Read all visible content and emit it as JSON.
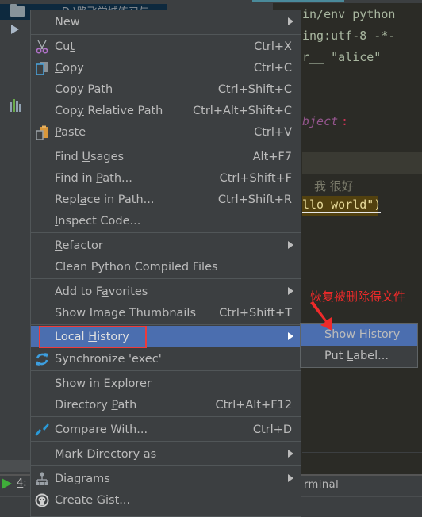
{
  "background": {
    "project_tree": {
      "selected_path": "D:\\路飞学城练习与",
      "expand_arrow": "tree-expand-arrow",
      "structure_icon": "structure-icon"
    },
    "editor": {
      "lines": [
        "in/env python",
        "ing:utf-8 -*-",
        "r__ \"alice\"",
        "bject",
        ":",
        "我 很好",
        "llo world\")"
      ]
    },
    "bottom_bar": {
      "run_tab_num": "4",
      "run_tab_rest": ": R",
      "terminal_tab": "rminal"
    }
  },
  "context_menu": {
    "items": [
      {
        "label": "New",
        "shortcut": "",
        "submenu": true
      },
      {
        "label": "Cut",
        "underline": "t",
        "shortcut": "Ctrl+X",
        "icon": "scissors-icon"
      },
      {
        "label": "Copy",
        "underline": "C",
        "shortcut": "Ctrl+C",
        "icon": "copy-icon"
      },
      {
        "label": "Copy Path",
        "shortcut": "Ctrl+Shift+C"
      },
      {
        "label": "Copy Relative Path",
        "shortcut": "Ctrl+Alt+Shift+C"
      },
      {
        "label": "Paste",
        "underline": "P",
        "shortcut": "Ctrl+V",
        "icon": "paste-icon"
      },
      {
        "label": "Find Usages",
        "shortcut": "Alt+F7"
      },
      {
        "label": "Find in Path...",
        "shortcut": "Ctrl+Shift+F"
      },
      {
        "label": "Replace in Path...",
        "shortcut": "Ctrl+Shift+R"
      },
      {
        "label": "Inspect Code...",
        "shortcut": ""
      },
      {
        "label": "Refactor",
        "shortcut": "",
        "submenu": true
      },
      {
        "label": "Clean Python Compiled Files",
        "shortcut": ""
      },
      {
        "label": "Add to Favorites",
        "shortcut": "",
        "submenu": true
      },
      {
        "label": "Show Image Thumbnails",
        "shortcut": "Ctrl+Shift+T"
      },
      {
        "label": "Local History",
        "shortcut": "",
        "submenu": true,
        "active": true
      },
      {
        "label": "Synchronize 'exec'",
        "shortcut": "",
        "icon": "synchronize-icon"
      },
      {
        "label": "Show in Explorer",
        "shortcut": ""
      },
      {
        "label": "Directory Path",
        "shortcut": "Ctrl+Alt+F12"
      },
      {
        "label": "Compare With...",
        "shortcut": "Ctrl+D",
        "icon": "compare-icon"
      },
      {
        "label": "Mark Directory as",
        "shortcut": "",
        "submenu": true
      },
      {
        "label": "Diagrams",
        "shortcut": "",
        "submenu": true,
        "icon": "diagrams-icon"
      },
      {
        "label": "Create Gist...",
        "shortcut": "",
        "icon": "github-icon"
      }
    ]
  },
  "local_history_submenu": {
    "items": [
      {
        "label": "Show History",
        "active": true
      },
      {
        "label": "Put Label..."
      }
    ]
  },
  "annotation": {
    "text": "恢复被删除得文件",
    "color": "#ee2a2a"
  },
  "colors": {
    "menu_bg": "#3c3f41",
    "selection": "#4b6eaf",
    "highlight_box": "#ee3b3b",
    "editor_bg": "#2b2b26"
  }
}
